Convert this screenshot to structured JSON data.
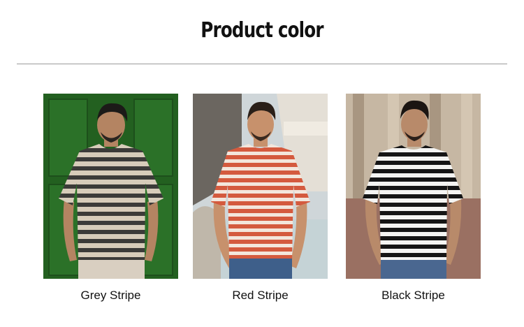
{
  "page": {
    "title": "Product color"
  },
  "products": [
    {
      "caption": "Grey Stripe",
      "shirt_color": "#3c3b39",
      "stripe_color": "#d7ccba",
      "background": "#2f6b2a"
    },
    {
      "caption": "Red Stripe",
      "shirt_color": "#d45a3e",
      "stripe_color": "#f3e6dc",
      "background": "#cfd6d9"
    },
    {
      "caption": "Black Stripe",
      "shirt_color": "#151515",
      "stripe_color": "#f4f4f2",
      "background": "#b9a58f"
    }
  ],
  "icons": [
    "product-photo"
  ]
}
